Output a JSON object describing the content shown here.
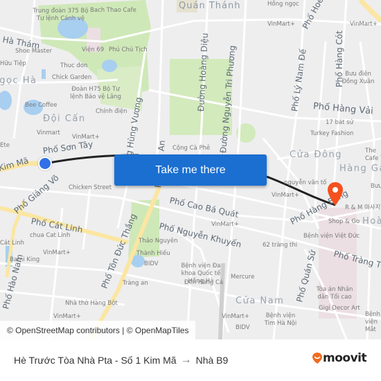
{
  "map": {
    "button_label": "Take me there",
    "attribution": "© OpenStreetMap contributors | © OpenMapTiles",
    "colors": {
      "background": "#eeeeef",
      "road": "#ffffff",
      "major_road": "#fbe6a2",
      "park": "#cfe8b8",
      "water": "#a8cff0",
      "route_line": "#222222",
      "origin": "#3070e8",
      "destination": "#f4511e",
      "button": "#1a6fd1"
    },
    "streets": [
      {
        "name": "Quán Thánh"
      },
      {
        "name": "Phố Hoè Nhai"
      },
      {
        "name": "Phố Hàng Cót"
      },
      {
        "name": "Phố Lý Nam Đế"
      },
      {
        "name": "Đường Hoàng Diệu"
      },
      {
        "name": "Đường Nguyễn Tri Phương"
      },
      {
        "name": "Phố Hàng Vải"
      },
      {
        "name": "Đường Hùng Vương"
      },
      {
        "name": "Phố Văn An"
      },
      {
        "name": "Phố Sơn Tây"
      },
      {
        "name": "Phố Giảng Võ"
      },
      {
        "name": "Phố Cát Linh"
      },
      {
        "name": "Phố Cao Bá Quát"
      },
      {
        "name": "Phố Nguyễn Khuyến"
      },
      {
        "name": "Phố Tôn Đức Thắng"
      },
      {
        "name": "Phố Hào Nam"
      },
      {
        "name": "Phố Quán Sứ"
      },
      {
        "name": "Phố Tràng Thi"
      },
      {
        "name": "Phố Hàng Bông"
      },
      {
        "name": "Kim Mã"
      },
      {
        "name": "Ngọc Hà Thám"
      }
    ],
    "districts": [
      {
        "name": "Đội Cấn"
      },
      {
        "name": "Cửa Đông"
      },
      {
        "name": "Hàng Gai"
      },
      {
        "name": "Cửa Nam"
      },
      {
        "name": "Hoàn"
      },
      {
        "name": "Ngọc Hà"
      }
    ],
    "pois": [
      {
        "name": "Trung đoàn 375 Bộ Tư lệnh Cảnh vệ"
      },
      {
        "name": "Bach Thao Cafe"
      },
      {
        "name": "Shoe Master"
      },
      {
        "name": "Viện 69"
      },
      {
        "name": "Phủ Chủ Tịch"
      },
      {
        "name": "Hữu Tiệp"
      },
      {
        "name": "Thuc don"
      },
      {
        "name": "Chick Garden"
      },
      {
        "name": "Đoàn H75 Bộ Tư lệnh Bảo vệ Lăng"
      },
      {
        "name": "Bee Coffee"
      },
      {
        "name": "Chính điện"
      },
      {
        "name": "Vinmart"
      },
      {
        "name": "VinMart+"
      },
      {
        "name": "Ete"
      },
      {
        "name": "Cộng Cà Phê"
      },
      {
        "name": "Hồng ngọc"
      },
      {
        "name": "Bưu điện Đồng Xuân"
      },
      {
        "name": "17 bát sứ"
      },
      {
        "name": "Turkey Fashion"
      },
      {
        "name": "The Cafe T"
      },
      {
        "name": "Chicken Street"
      },
      {
        "name": "nguyễn văn tố"
      },
      {
        "name": "Bưu"
      },
      {
        "name": "R & M 마사지"
      },
      {
        "name": "Shop & Go"
      },
      {
        "name": "Bệnh viện Việt Đức"
      },
      {
        "name": "62 tràng thi"
      },
      {
        "name": "chua Cat Linh"
      },
      {
        "name": "Cát Linh"
      },
      {
        "name": "Bami King"
      },
      {
        "name": "Thảo Nguyên"
      },
      {
        "name": "Thành Hiếu"
      },
      {
        "name": "BIDV"
      },
      {
        "name": "Bệnh viện Đa khoa Quốc tế Hồng Hà"
      },
      {
        "name": "Đền Hàng Cá"
      },
      {
        "name": "Mercure"
      },
      {
        "name": "Tràng an"
      },
      {
        "name": "Nhà thờ Hàng Bột"
      },
      {
        "name": "Tòa án Nhân dân Tối cao"
      },
      {
        "name": "Gigi Decor Art"
      },
      {
        "name": "Bệnh viện Tim Hà Nội"
      },
      {
        "name": "Bệnh viện Mắt"
      }
    ]
  },
  "footer": {
    "origin": "Hè Trước Tòa Nhà Pta - Số 1 Kim Mã",
    "arrow": "→",
    "destination": "Nhà B9",
    "brand": "moovit",
    "brand_color": "#f26b21"
  }
}
